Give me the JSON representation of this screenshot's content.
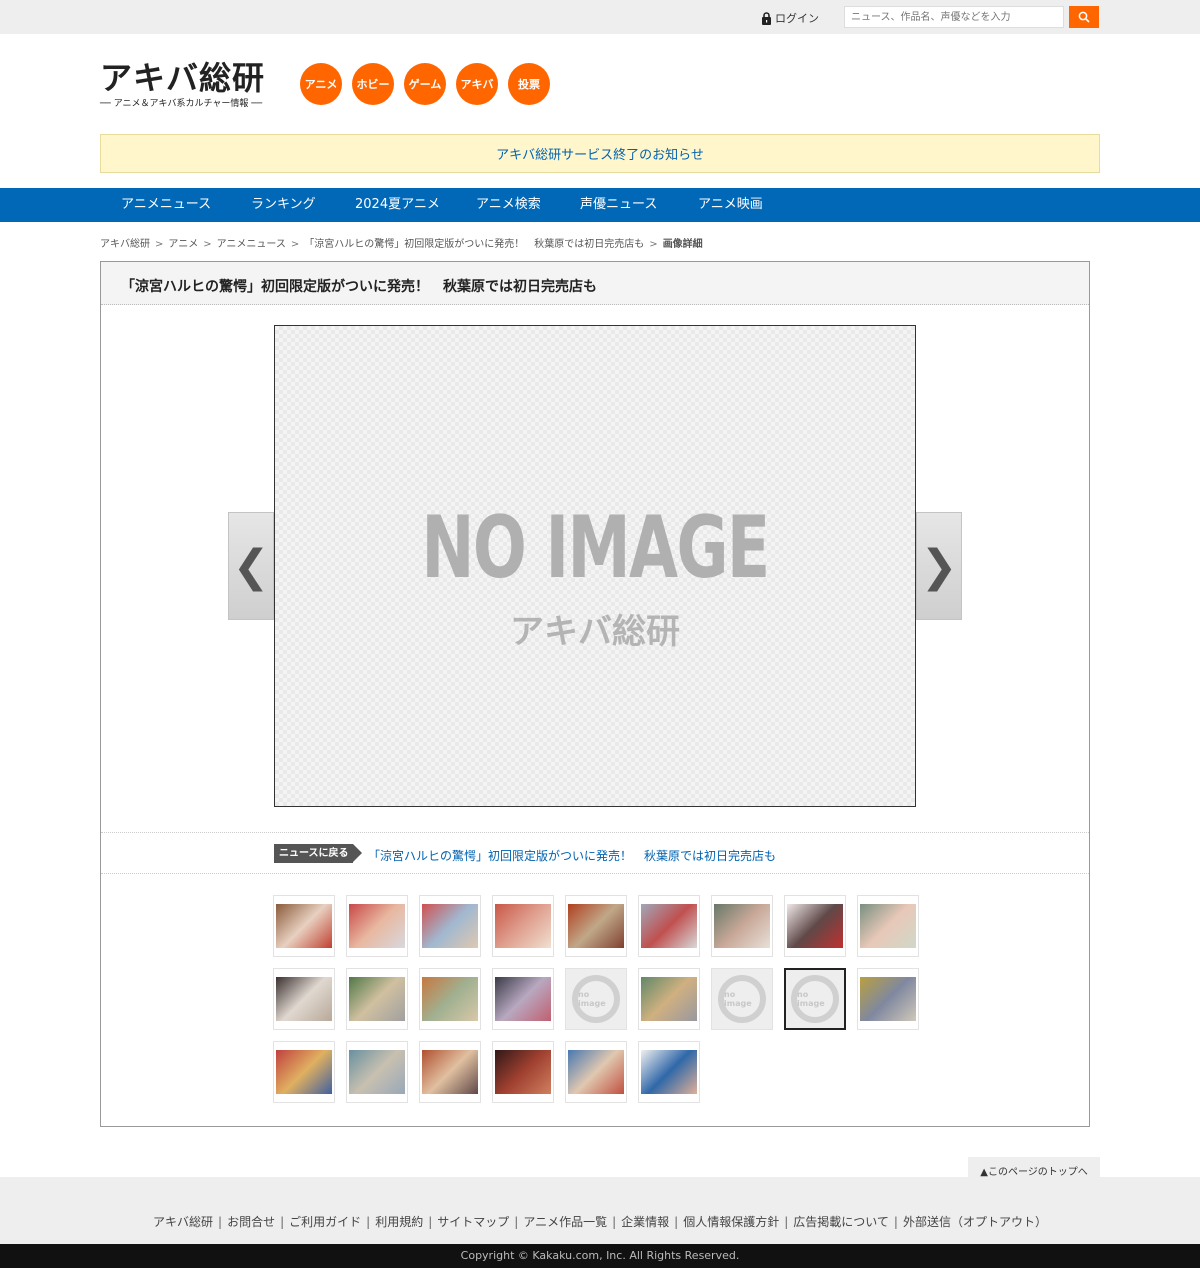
{
  "header": {
    "login_label": "ログイン",
    "search_placeholder": "ニュース、作品名、声優などを入力",
    "logo_main": "アキバ総研",
    "logo_sub": "── アニメ＆アキバ系カルチャー情報 ──",
    "categories": [
      "アニメ",
      "ホビー",
      "ゲーム",
      "アキバ",
      "投票"
    ]
  },
  "notice": "アキバ総研サービス終了のお知らせ",
  "gnav": [
    "アニメニュース",
    "ランキング",
    "2024夏アニメ",
    "アニメ検索",
    "声優ニュース",
    "アニメ映画"
  ],
  "breadcrumb": [
    "アキバ総研",
    "アニメ",
    "アニメニュース",
    "「涼宮ハルヒの驚愕」初回限定版がついに発売！　秋葉原では初日完売店も",
    "画像詳細"
  ],
  "breadcrumb_sep": ">",
  "article": {
    "title": "「涼宮ハルヒの驚愕」初回限定版がついに発売！　秋葉原では初日完売店も",
    "main_image": {
      "big_text": "NO IMAGE",
      "logo_text": "アキバ総研"
    },
    "prev_label": "❮",
    "next_label": "❯",
    "back_label": "ニュースに戻る",
    "back_link": "「涼宮ハルヒの驚愕」初回限定版がついに発売！　秋葉原では初日完売店も"
  },
  "thumbnails": [
    {
      "kind": "photo",
      "colors": [
        "#8a5a3a",
        "#e8d0c0",
        "#c04030"
      ]
    },
    {
      "kind": "photo",
      "colors": [
        "#c84848",
        "#e8b8a0",
        "#d8d8e0"
      ]
    },
    {
      "kind": "photo",
      "colors": [
        "#d05050",
        "#a0b8d0",
        "#e0c8b0"
      ]
    },
    {
      "kind": "photo",
      "colors": [
        "#c85848",
        "#e0a090",
        "#f0e0d0"
      ]
    },
    {
      "kind": "photo",
      "colors": [
        "#b04020",
        "#c0a888",
        "#804030"
      ]
    },
    {
      "kind": "photo",
      "colors": [
        "#a0a8b8",
        "#c05050",
        "#d8d8d8"
      ]
    },
    {
      "kind": "photo",
      "colors": [
        "#687868",
        "#c8a898",
        "#e8e0d8"
      ]
    },
    {
      "kind": "photo",
      "colors": [
        "#f0e8e8",
        "#604848",
        "#c03030"
      ]
    },
    {
      "kind": "photo",
      "colors": [
        "#789080",
        "#e8c8b8",
        "#d0d8c8"
      ]
    },
    {
      "kind": "photo",
      "colors": [
        "#3a3030",
        "#e0d8d0",
        "#b8a898"
      ]
    },
    {
      "kind": "photo",
      "colors": [
        "#507848",
        "#d0c0a0",
        "#a0a0a0"
      ]
    },
    {
      "kind": "photo",
      "colors": [
        "#c87840",
        "#a0b090",
        "#d8c8a8"
      ]
    },
    {
      "kind": "photo",
      "colors": [
        "#3a3a48",
        "#b8a8c0",
        "#c06070"
      ]
    },
    {
      "kind": "noimage",
      "label": "no image"
    },
    {
      "kind": "photo",
      "colors": [
        "#608868",
        "#d0b080",
        "#9898a0"
      ]
    },
    {
      "kind": "noimage",
      "label": "no image"
    },
    {
      "kind": "noimage",
      "label": "no image",
      "selected": true
    },
    {
      "kind": "photo",
      "colors": [
        "#b8a040",
        "#8088a0",
        "#d0c8b8"
      ]
    },
    {
      "kind": "photo",
      "colors": [
        "#c04040",
        "#e0b060",
        "#4060a0"
      ]
    },
    {
      "kind": "photo",
      "colors": [
        "#6890a0",
        "#c8c0b0",
        "#98a8b8"
      ]
    },
    {
      "kind": "photo",
      "colors": [
        "#b05030",
        "#e0c0a0",
        "#604848"
      ]
    },
    {
      "kind": "photo",
      "colors": [
        "#301818",
        "#a04030",
        "#d08060"
      ]
    },
    {
      "kind": "photo",
      "colors": [
        "#4878b0",
        "#e0c8b0",
        "#c05040"
      ]
    },
    {
      "kind": "photo",
      "colors": [
        "#f0f0f0",
        "#3068a8",
        "#e0b098"
      ]
    }
  ],
  "pagetop_label": "▲このページのトップへ",
  "footer": {
    "links": [
      "アキバ総研",
      "お問合せ",
      "ご利用ガイド",
      "利用規約",
      "サイトマップ",
      "アニメ作品一覧",
      "企業情報",
      "個人情報保護方針",
      "広告掲載について",
      "外部送信（オプトアウト）"
    ],
    "copyright": "Copyright © Kakaku.com, Inc. All Rights Reserved."
  },
  "colors": {
    "accent": "#ff6600",
    "nav": "#0068b7",
    "link": "#0062b0",
    "notice_bg": "#fff6cc"
  }
}
